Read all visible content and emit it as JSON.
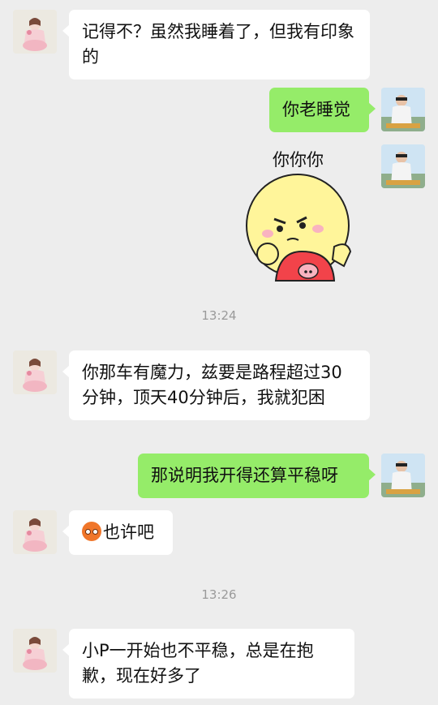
{
  "messages": {
    "m1_text": "记得不？虽然我睡着了，但我有印象的",
    "m2_text": "你老睡觉",
    "sticker_caption": "你你你",
    "m4_text": "你那车有魔力，兹要是路程超过30分钟，顶天40分钟后，我就犯困",
    "m5_text": "那说明我开得还算平稳呀",
    "m6_text": "也许吧",
    "m7_text": "小P一开始也不平稳，总是在抱歉，现在好多了"
  },
  "timestamps": {
    "t1": "13:24",
    "t2": "13:26"
  },
  "emoji": {
    "m6_icon": "orange-face-emoji"
  },
  "colors": {
    "background": "#ededed",
    "incoming_bubble": "#ffffff",
    "outgoing_bubble": "#95ec69",
    "timestamp": "#9a9a9a"
  }
}
